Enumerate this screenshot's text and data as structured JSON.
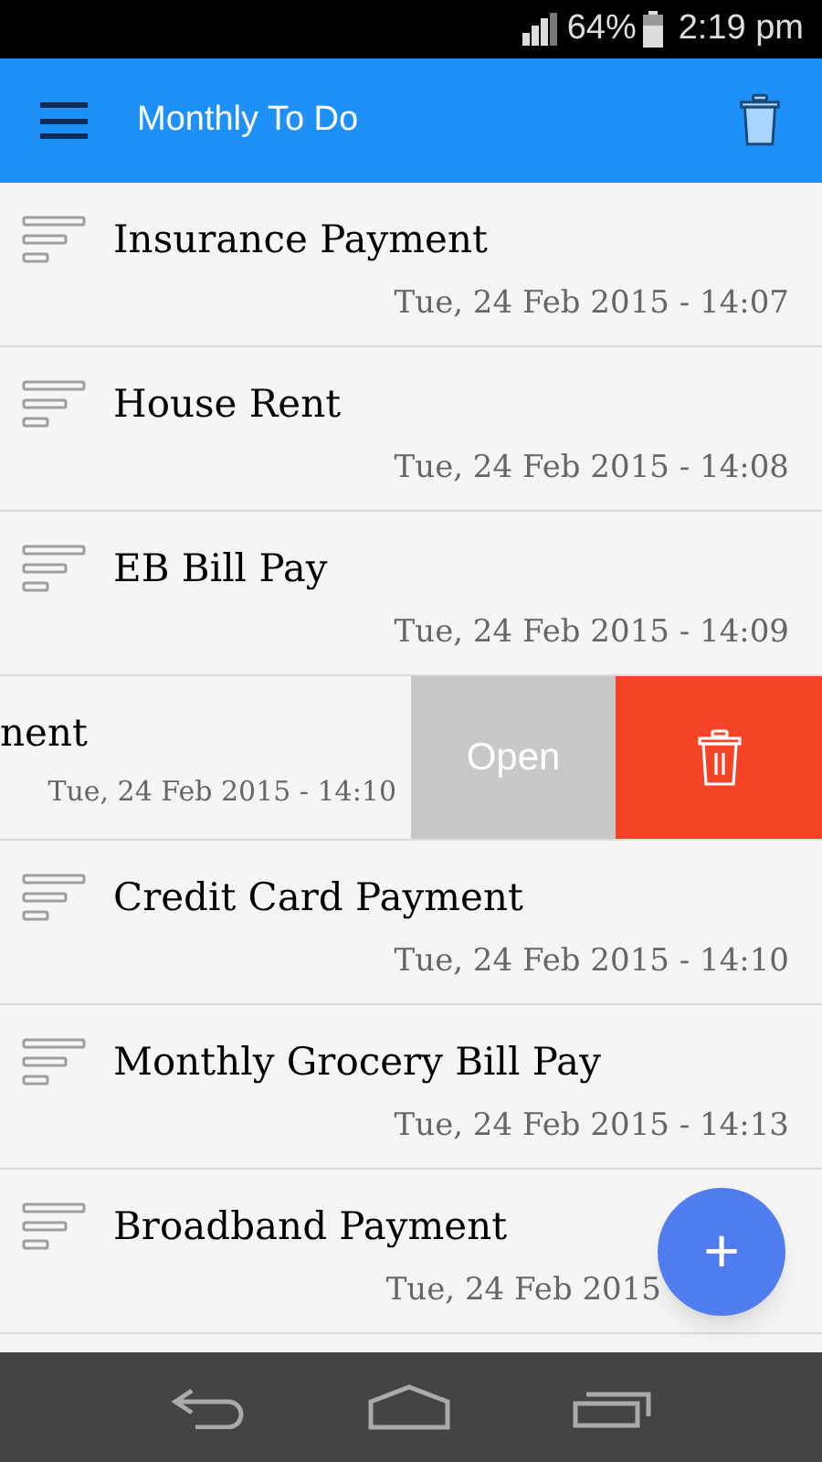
{
  "status_bar": {
    "battery": "64%",
    "time": "2:19 pm"
  },
  "app_bar": {
    "title": "Monthly To Do"
  },
  "items": [
    {
      "kind": "normal",
      "title": "Insurance Payment",
      "date": "Tue, 24 Feb 2015 - 14:07"
    },
    {
      "kind": "normal",
      "title": "House Rent",
      "date": "Tue, 24 Feb 2015 - 14:08"
    },
    {
      "kind": "normal",
      "title": "EB Bill Pay",
      "date": "Tue, 24 Feb 2015 - 14:09"
    },
    {
      "kind": "swiped",
      "title": "nent",
      "date": "Tue, 24 Feb 2015 - 14:10",
      "action": "Open"
    },
    {
      "kind": "normal",
      "title": "Credit Card Payment",
      "date": "Tue, 24 Feb 2015 - 14:10"
    },
    {
      "kind": "normal",
      "title": "Monthly Grocery Bill Pay",
      "date": "Tue, 24 Feb 2015 - 14:13"
    },
    {
      "kind": "normal",
      "title": "Broadband Payment",
      "date": "Tue, 24 Feb 2015"
    }
  ],
  "fab": {
    "label": "+"
  }
}
